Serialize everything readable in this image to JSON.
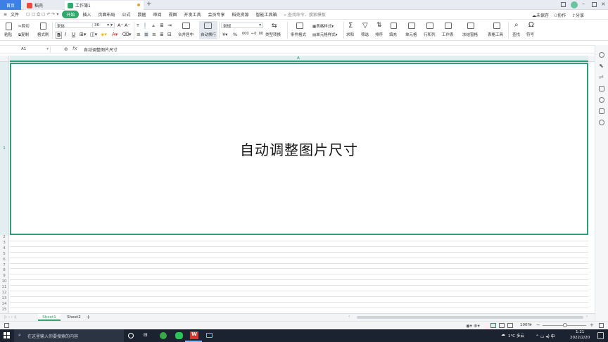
{
  "tabs": {
    "home": "首页",
    "rec": "稻壳",
    "book": "工作簿1"
  },
  "menu": {
    "file": "文件",
    "items": [
      "开始",
      "插入",
      "页面布局",
      "公式",
      "数据",
      "审阅",
      "视图",
      "开发工具",
      "会员专享",
      "稻壳资源",
      "智能工具箱"
    ],
    "search_placeholder": "查找命令、搜索模板",
    "unsync": "未保存",
    "collab": "协作",
    "share": "分享"
  },
  "ribbon": {
    "paste": "粘贴",
    "cut": "剪切",
    "copy": "复制",
    "format_painter": "格式刷",
    "font_name": "宋体",
    "font_size": "36",
    "merge_center": "合并居中",
    "auto_wrap": "自动换行",
    "number_format": "常规",
    "type_convert": "类型转换",
    "table_style": "表格样式",
    "cond_format": "条件格式",
    "cell_style": "单元格样式",
    "sum": "求和",
    "filter": "筛选",
    "sort": "排序",
    "fill": "填充",
    "cell": "单元格",
    "row_col": "行和列",
    "worksheet": "工作表",
    "freeze": "冻结窗格",
    "table_tools": "表格工具",
    "find": "查找",
    "symbol": "符号",
    "currency": "¥",
    "percent": "%",
    "thousands": "000"
  },
  "formula": {
    "cell_ref": "A1",
    "fx": "fx",
    "content": "自动调整图片尺寸"
  },
  "grid": {
    "col_a": "A",
    "cell_text": "自动调整图片尺寸",
    "rows": [
      "1",
      "2",
      "3",
      "4",
      "5",
      "6",
      "7",
      "8",
      "9",
      "10",
      "11",
      "12",
      "13",
      "14",
      "15"
    ]
  },
  "sheets": {
    "sheet1": "Sheet1",
    "sheet2": "Sheet2",
    "add": "+"
  },
  "status": {
    "zoom": "100%"
  },
  "taskbar": {
    "search_placeholder": "在这里输入你要搜索的内容",
    "weather": "1°C 多云",
    "time": "1:21",
    "date": "2022/2/20"
  },
  "colors": {
    "accent_green": "#2ea86b",
    "home_tab_blue": "#3d7fe6",
    "cell_border": "#2e9e76",
    "taskbar": "#1b2330"
  }
}
